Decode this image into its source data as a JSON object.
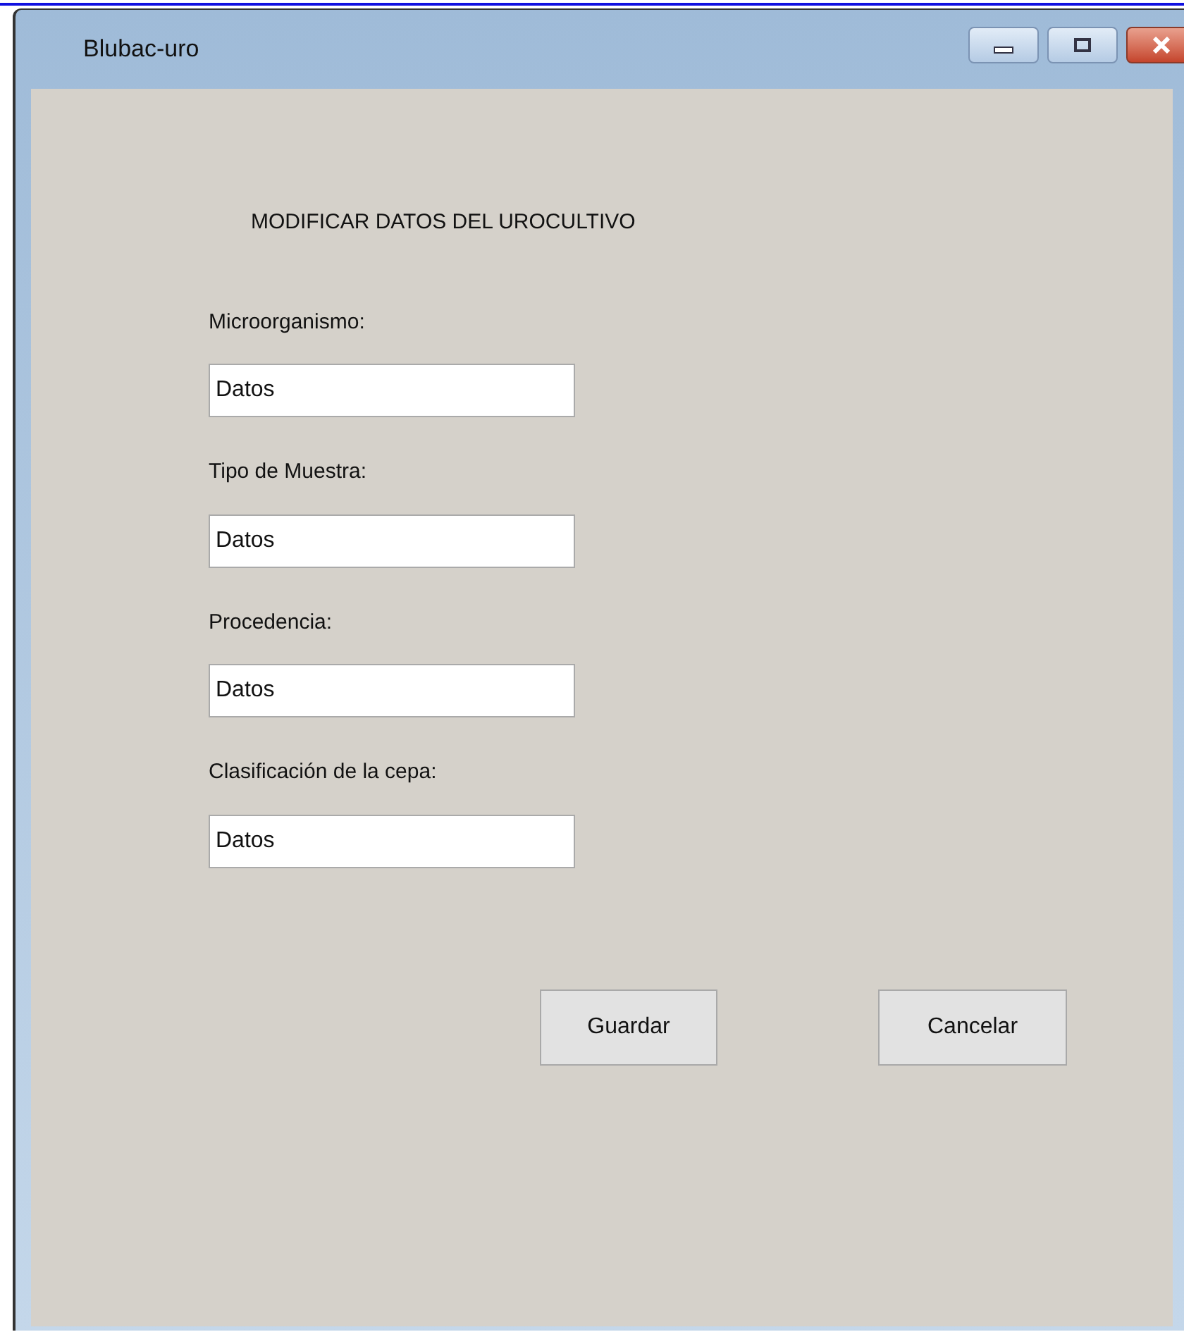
{
  "window": {
    "title": "Blubac-uro"
  },
  "heading": "MODIFICAR DATOS DEL UROCULTIVO",
  "fields": [
    {
      "label": "Microorganismo:",
      "value": "Datos"
    },
    {
      "label": "Tipo de Muestra:",
      "value": "Datos"
    },
    {
      "label": "Procedencia:",
      "value": "Datos"
    },
    {
      "label": "Clasificación de la cepa:",
      "value": "Datos"
    }
  ],
  "buttons": [
    "Guardar",
    "Cancelar"
  ]
}
